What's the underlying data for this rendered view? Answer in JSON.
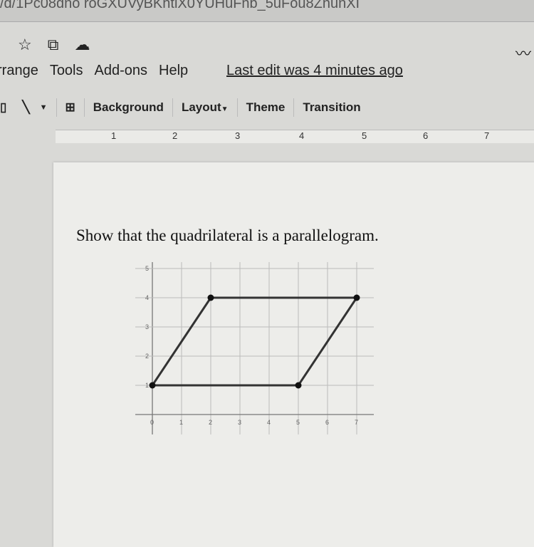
{
  "browser": {
    "url_fragment": "/d/1Pc08dno roGXUVyBKhtiX0YUHuFnb_5uFou8ZnunXI"
  },
  "toolbar_icons": [
    "star-icon",
    "move-to-folder-icon",
    "cloud-saved-icon"
  ],
  "top_right_icon": "activity-trend-icon",
  "menu": {
    "items": [
      "rrange",
      "Tools",
      "Add-ons",
      "Help"
    ],
    "last_edit": "Last edit was 4 minutes ago"
  },
  "toolbar": {
    "background": "Background",
    "layout": "Layout",
    "theme": "Theme",
    "transition": "Transition"
  },
  "ruler": {
    "ticks": [
      "1",
      "2",
      "3",
      "4",
      "5",
      "6",
      "7"
    ]
  },
  "slide": {
    "question": "Show that the quadrilateral is a parallelogram."
  },
  "chart_data": {
    "type": "line",
    "xlim": [
      0,
      7
    ],
    "ylim": [
      0,
      5
    ],
    "grid": true,
    "x_ticks": [
      "0",
      "1",
      "2",
      "3",
      "4",
      "5",
      "6",
      "7"
    ],
    "y_ticks": [
      "1",
      "2",
      "3",
      "4",
      "5"
    ],
    "polygon": [
      {
        "x": 0,
        "y": 1
      },
      {
        "x": 2,
        "y": 4
      },
      {
        "x": 7,
        "y": 4
      },
      {
        "x": 5,
        "y": 1
      }
    ]
  }
}
